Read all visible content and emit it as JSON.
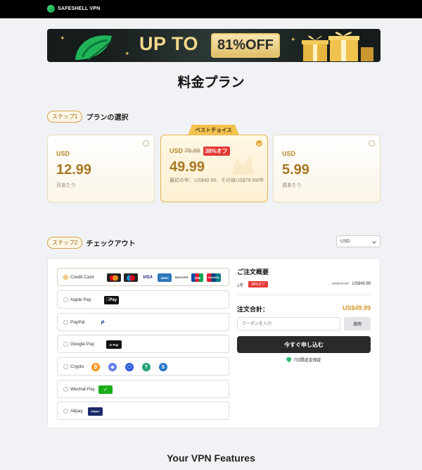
{
  "header": {
    "brand": "SAFESHELL VPN"
  },
  "banner": {
    "headline": "UP TO",
    "discount": "81%OFF"
  },
  "page_title": "料金プラン",
  "step1": {
    "pill": "ステップ1",
    "title": "プランの選択"
  },
  "best_choice_label": "ベストチョイス",
  "plans": [
    {
      "currency": "USD",
      "price": "12.99",
      "subtitle": "月あたり",
      "selected": false
    },
    {
      "currency": "USD",
      "old_price": "79.99",
      "discount_badge": "38%オフ",
      "price": "49.99",
      "subtitle": "最初の年：US$49.99、その後US$79.99/年",
      "selected": true
    },
    {
      "currency": "USD",
      "price": "5.99",
      "subtitle": "週あたり",
      "selected": false
    }
  ],
  "step2": {
    "pill": "ステップ2",
    "title": "チェックアウト"
  },
  "currency_select": {
    "value": "USD"
  },
  "payment_methods": [
    {
      "label": "Credit Card",
      "selected": true
    },
    {
      "label": "Apple Pay",
      "selected": false
    },
    {
      "label": "PayPal",
      "selected": false
    },
    {
      "label": "Google Pay",
      "selected": false
    },
    {
      "label": "Crypto",
      "selected": false
    },
    {
      "label": "Wechat Pay",
      "selected": false
    },
    {
      "label": "Alipay",
      "selected": false
    }
  ],
  "card_brands": [
    "VISA",
    "AMEX",
    "DISCOVER",
    "JCB",
    "UnionPay"
  ],
  "wallet_badges": {
    "apple": "Pay",
    "google": "G Pay",
    "alipay": "Alipay+"
  },
  "summary": {
    "title": "ご注文概要",
    "period": "1年",
    "discount_badge": "38%オフ",
    "old_price": "US$79.99",
    "price": "US$49.99",
    "total_label": "注文合計：",
    "total_value": "US$49.99",
    "coupon_placeholder": "クーポンを入力",
    "apply_label": "適用",
    "order_button": "今すぐ申し込む",
    "guarantee": "7日間返金保証"
  },
  "features_title": "Your VPN Features",
  "colors": {
    "accent_gold": "#d29a2b",
    "badge_red": "#e53935",
    "button_dark": "#2a2a2a",
    "shield_green": "#2eb872"
  }
}
